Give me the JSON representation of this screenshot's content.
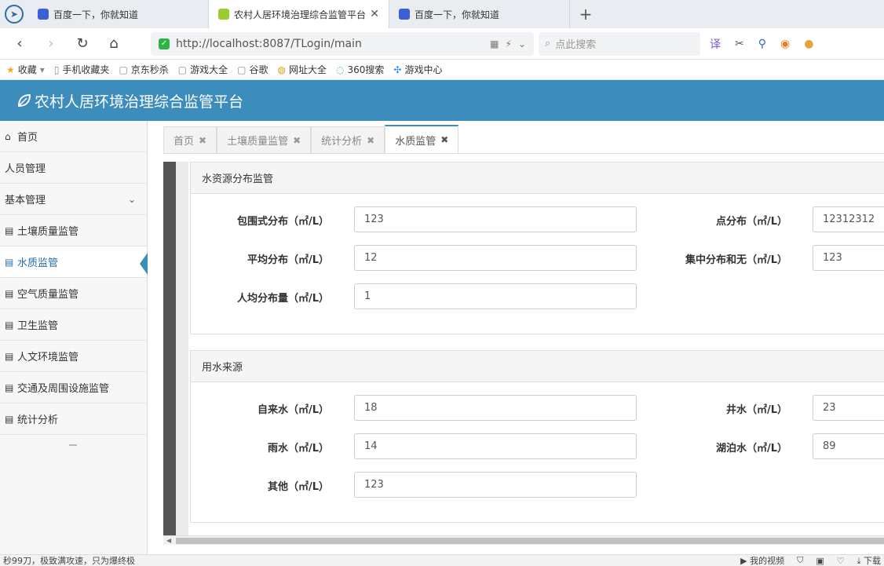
{
  "browser": {
    "tabs": [
      {
        "title": "百度一下，你就知道",
        "active": false
      },
      {
        "title": "农村人居环境治理综合监管平台",
        "active": true
      },
      {
        "title": "百度一下，你就知道",
        "active": false
      }
    ],
    "url": "http://localhost:8087/TLogin/main",
    "search_placeholder": "点此搜索",
    "bookmarks": [
      "收藏",
      "手机收藏夹",
      "京东秒杀",
      "游戏大全",
      "谷歌",
      "网址大全",
      "360搜索",
      "游戏中心"
    ]
  },
  "app": {
    "title": "农村人居环境治理综合监管平台"
  },
  "sidebar": {
    "items": [
      {
        "label": "首页",
        "icon": "home-icon"
      },
      {
        "label": "人员管理",
        "icon": ""
      },
      {
        "label": "基本管理",
        "icon": "",
        "expandable": true
      },
      {
        "label": "土壤质量监管",
        "icon": "list-icon"
      },
      {
        "label": "水质监管",
        "icon": "list-icon",
        "active": true
      },
      {
        "label": "空气质量监管",
        "icon": "list-icon"
      },
      {
        "label": "卫生监管",
        "icon": "list-icon"
      },
      {
        "label": "人文环境监管",
        "icon": "list-icon"
      },
      {
        "label": "交通及周围设施监管",
        "icon": "list-icon"
      },
      {
        "label": "统计分析",
        "icon": "list-icon"
      }
    ]
  },
  "content_tabs": [
    {
      "label": "首页"
    },
    {
      "label": "土壤质量监管"
    },
    {
      "label": "统计分析"
    },
    {
      "label": "水质监管",
      "active": true
    }
  ],
  "panels": {
    "distribution": {
      "title": "水资源分布监管",
      "fields": [
        {
          "label": "包围式分布（㎡/L）",
          "value": "123"
        },
        {
          "label": "点分布（㎡/L）",
          "value": "12312312"
        },
        {
          "label": "平均分布（㎡/L）",
          "value": "12"
        },
        {
          "label": "集中分布和无（㎡/L）",
          "value": "123"
        },
        {
          "label": "人均分布量（㎡/L）",
          "value": "1"
        }
      ]
    },
    "source": {
      "title": "用水来源",
      "fields": [
        {
          "label": "自来水（㎡/L）",
          "value": "18"
        },
        {
          "label": "井水（㎡/L）",
          "value": "23"
        },
        {
          "label": "雨水（㎡/L）",
          "value": "14"
        },
        {
          "label": "湖泊水（㎡/L）",
          "value": "89"
        },
        {
          "label": "其他（㎡/L）",
          "value": "123"
        }
      ]
    }
  },
  "statusbar": {
    "left": "秒99刀，极致满攻速，只为爆终极",
    "right": [
      "我的视频",
      "下载"
    ]
  },
  "colors": {
    "header": "#3c8dbc",
    "active_nav": "#2a6fa8"
  }
}
